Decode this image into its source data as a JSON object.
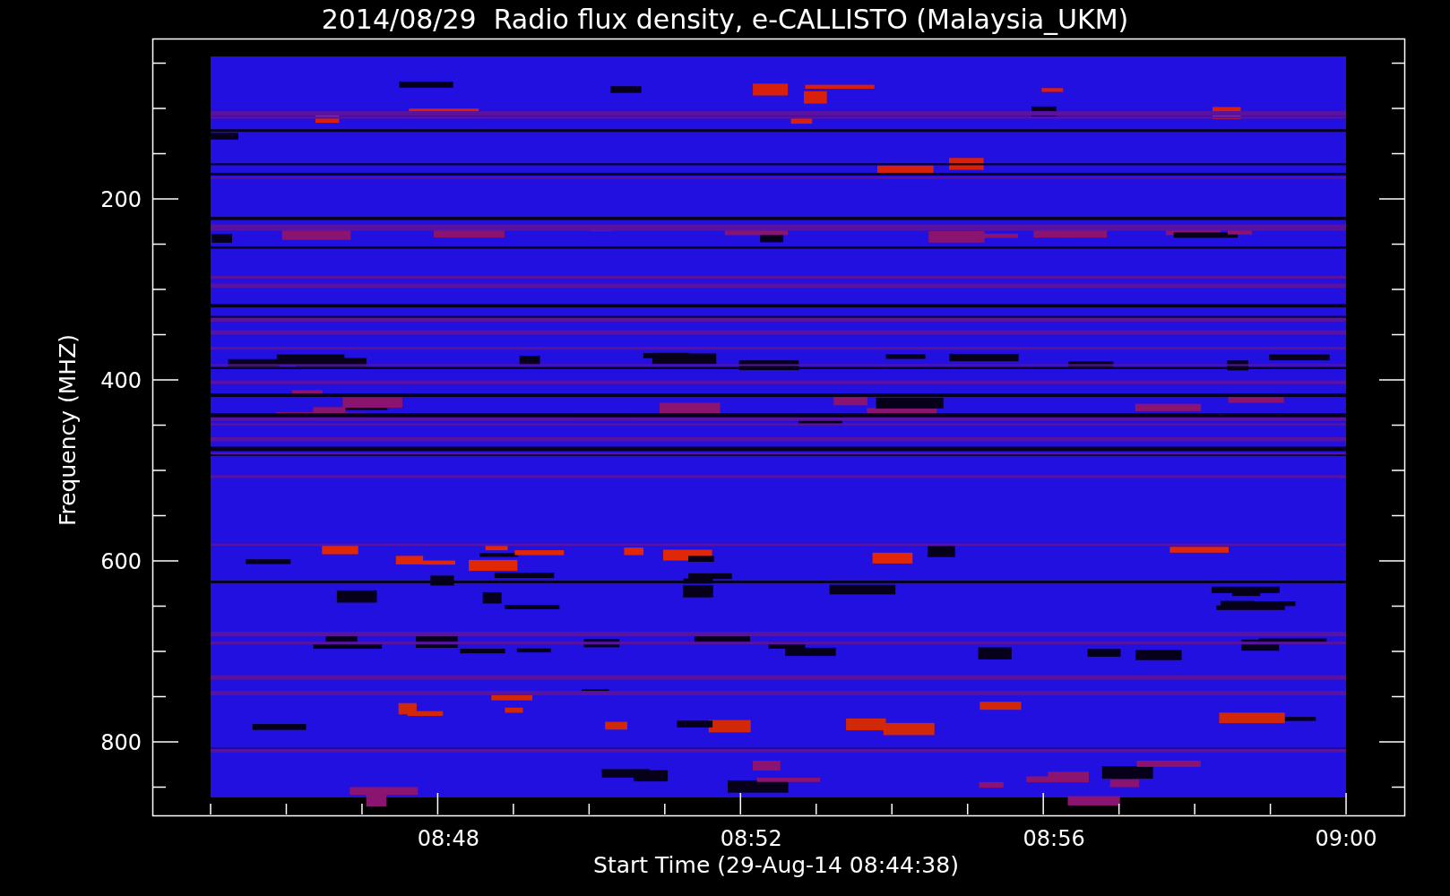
{
  "title": "2014/08/29  Radio flux density, e-CALLISTO (Malaysia_UKM)",
  "y_axis": {
    "label": "Frequency (MHZ)",
    "ticks": [
      "200",
      "400",
      "600",
      "800"
    ]
  },
  "x_axis": {
    "label": "Start Time (29-Aug-14 08:44:38)",
    "ticks": [
      "08:48",
      "08:52",
      "08:56",
      "09:00"
    ]
  }
}
